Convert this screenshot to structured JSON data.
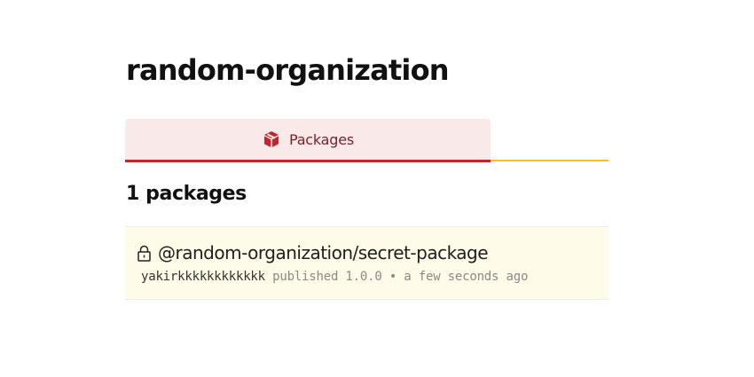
{
  "org": {
    "title": "random-organization"
  },
  "tabs": [
    {
      "label": "Packages",
      "icon": "package-icon",
      "active": true
    }
  ],
  "packages_section": {
    "count_label": "1 packages",
    "items": [
      {
        "name": "@random-organization/secret-package",
        "private": true,
        "publisher": "yakirkkkkkkkkkkkk",
        "published_label": "published",
        "version": "1.0.0",
        "separator": "•",
        "time_ago": "a few seconds ago"
      }
    ]
  },
  "colors": {
    "tab_active_bg": "#f9e9e9",
    "tab_active_border": "#c0272d",
    "tab_strip_line": "#f0c419",
    "package_row_bg": "#fefbe8",
    "icon_red": "#c0272d"
  }
}
